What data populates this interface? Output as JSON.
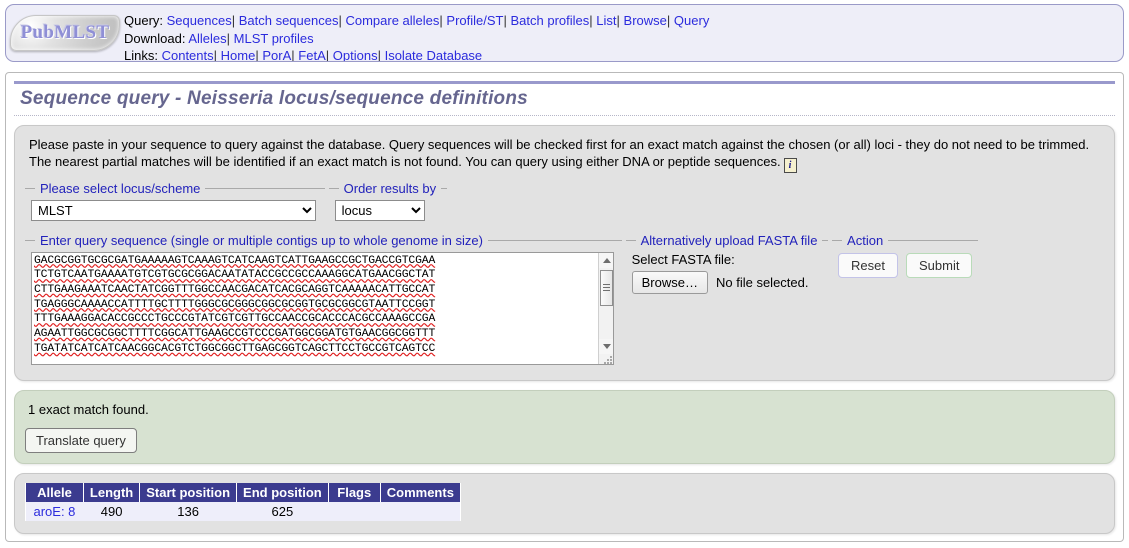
{
  "header": {
    "logo_text": "PubMLST",
    "rows": [
      {
        "label": "Query:",
        "links": [
          "Sequences",
          "Batch sequences",
          "Compare alleles",
          "Profile/ST",
          "Batch profiles",
          "List",
          "Browse",
          "Query"
        ]
      },
      {
        "label": "Download:",
        "links": [
          "Alleles",
          "MLST profiles"
        ]
      },
      {
        "label": "Links:",
        "links": [
          "Contents",
          "Home",
          "PorA",
          "FetA",
          "Options",
          "Isolate Database"
        ]
      }
    ],
    "separator": "|"
  },
  "page_title": "Sequence query - Neisseria locus/sequence definitions",
  "description": {
    "text": "Please paste in your sequence to query against the database. Query sequences will be checked first for an exact match against the chosen (or all) loci - they do not need to be trimmed. The nearest partial matches will be identified if an exact match is not found. You can query using either DNA or peptide sequences.",
    "info_icon": "i"
  },
  "form": {
    "locus_fieldset_legend": "Please select locus/scheme",
    "locus_value": "MLST",
    "order_fieldset_legend": "Order results by",
    "order_value": "locus",
    "sequence_fieldset_legend": "Enter query sequence (single or multiple contigs up to whole genome in size)",
    "sequence_value": "GACGCGGTGCGCGATGAAAAAGTCAAAGTCATCAAGTCATTGAAGCCGCTGACCGTCGAA\nTCTGTCAATGAAAATGTCGTGCGCGGACAATATACCGCCGCCAAAGGCATGAACGGCTAT\nCTTGAAGAAATCAACTATCGGTTTGGCCAACGACATCACGCAGGTCAAAAACATTGCCAT\nTGAGGGCAAAACCATTTTGCTTTTGGGCGCGGGCGGCGCGGTGCGCGGCGTAATTCCGGT\nTTTGAAAGGACACCGCCCTGCCCGTATCGTCGTTGCCAACCGCACCCACGCCAAAGCCGA\nAGAATTGGCGCGGCTTTTCGGCATTGAAGCCGTCCCGATGGCGGATGTGAACGGCGGTTT\nTGATATCATCATCAACGGCACGTCTGGCGGCTTGAGCGGTCAGCTTCCTGCCGTCAGTCC",
    "fasta_fieldset_legend": "Alternatively upload FASTA file",
    "fasta_label": "Select FASTA file:",
    "browse_button": "Browse…",
    "file_status": "No file selected.",
    "action_fieldset_legend": "Action",
    "reset_button": "Reset",
    "submit_button": "Submit"
  },
  "results": {
    "message": "1 exact match found.",
    "translate_button": "Translate query",
    "table": {
      "columns": [
        "Allele",
        "Length",
        "Start position",
        "End position",
        "Flags",
        "Comments"
      ],
      "rows": [
        {
          "allele": "aroE: 8",
          "length": "490",
          "start_position": "136",
          "end_position": "625",
          "flags": "",
          "comments": ""
        }
      ]
    }
  },
  "colors": {
    "link": "#2b2bdd",
    "title": "#66668f",
    "legend": "#2222bb",
    "table_header_bg": "#3b3b8f",
    "results_panel_bg": "#d7e2d1",
    "panel_bg": "#e2e2e2"
  }
}
